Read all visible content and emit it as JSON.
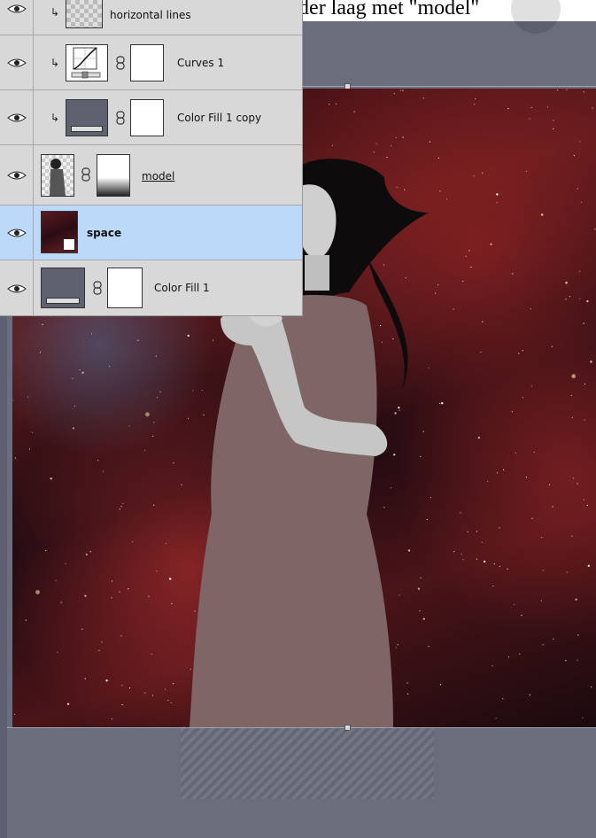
{
  "caption": {
    "text": "Voeg de \"space\" afbeelding toe onder laag met \"model\""
  },
  "layers": [
    {
      "name": "horizontal lines",
      "style": "normal",
      "clipped": true,
      "has_mask": false,
      "thumb": "pattern-thumb",
      "selected": false
    },
    {
      "name": "Curves 1",
      "style": "normal",
      "clipped": true,
      "has_mask": true,
      "thumb": "curves-adjustment-thumb",
      "selected": false
    },
    {
      "name": "Color Fill 1 copy",
      "style": "normal",
      "clipped": true,
      "has_mask": true,
      "thumb": "color-fill-thumb",
      "selected": false
    },
    {
      "name": "model",
      "style": "underlined",
      "clipped": false,
      "has_mask": true,
      "thumb": "model-thumb",
      "selected": false
    },
    {
      "name": "space",
      "style": "bold",
      "clipped": false,
      "has_mask": false,
      "thumb": "space-smart-object-thumb",
      "selected": true
    },
    {
      "name": "Color Fill 1",
      "style": "normal",
      "clipped": false,
      "has_mask": true,
      "thumb": "color-fill-thumb",
      "selected": false
    }
  ],
  "colors": {
    "panel_bg": "#d8d8d8",
    "selected_row": "#bcd9f9",
    "canvas_fill": "#5e6270"
  }
}
